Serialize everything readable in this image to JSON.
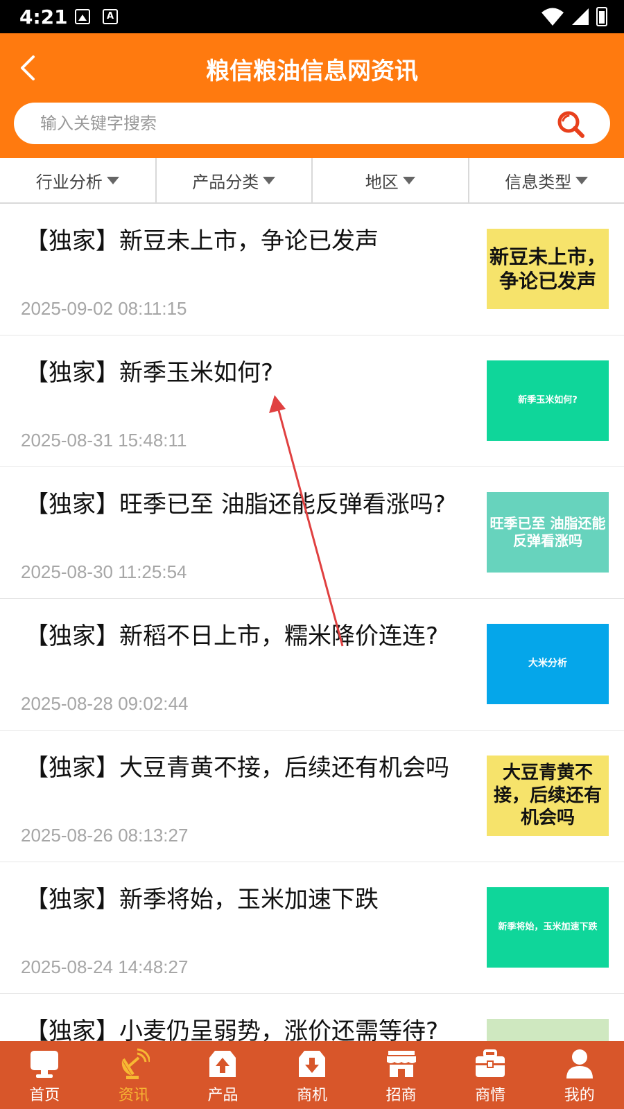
{
  "status_bar": {
    "time": "4:21"
  },
  "header": {
    "title": "粮信粮油信息网资讯"
  },
  "search": {
    "placeholder": "输入关键字搜索"
  },
  "filters": [
    {
      "label": "行业分析"
    },
    {
      "label": "产品分类"
    },
    {
      "label": "地区"
    },
    {
      "label": "信息类型"
    }
  ],
  "news": [
    {
      "title": "【独家】新豆未上市，争论已发声",
      "date": "2025-09-02 08:11:15",
      "thumb_text": "新豆未上市，争论已发声",
      "thumb_bg": "#f6e36b",
      "thumb_color": "#111111"
    },
    {
      "title": "【独家】新季玉米如何?",
      "date": "2025-08-31 15:48:11",
      "thumb_text": "新季玉米如何?",
      "thumb_bg": "#0fd69a",
      "thumb_color": "#ffffff"
    },
    {
      "title": "【独家】旺季已至 油脂还能反弹看涨吗?",
      "date": "2025-08-30 11:25:54",
      "thumb_text": "旺季已至 油脂还能反弹看涨吗",
      "thumb_bg": "#67d3bd",
      "thumb_color": "#ffffff"
    },
    {
      "title": "【独家】新稻不日上市，糯米降价连连?",
      "date": "2025-08-28 09:02:44",
      "thumb_text": "大米分析",
      "thumb_bg": "#05a6ea",
      "thumb_color": "#ffffff"
    },
    {
      "title": "【独家】大豆青黄不接，后续还有机会吗",
      "date": "2025-08-26 08:13:27",
      "thumb_text": "大豆青黄不接，后续还有机会吗",
      "thumb_bg": "#f6e36b",
      "thumb_color": "#111111"
    },
    {
      "title": "【独家】新季将始，玉米加速下跌",
      "date": "2025-08-24 14:48:27",
      "thumb_text": "新季将始，玉米加速下跌",
      "thumb_bg": "#0fd69a",
      "thumb_color": "#ffffff"
    },
    {
      "title": "【独家】小麦仍呈弱势，涨价还需等待?",
      "date": "",
      "thumb_text": "",
      "thumb_bg": "#cfe8c0",
      "thumb_color": "#111111"
    }
  ],
  "bottom_nav": [
    {
      "label": "首页",
      "icon": "monitor-icon"
    },
    {
      "label": "资讯",
      "icon": "satellite-dish-icon"
    },
    {
      "label": "产品",
      "icon": "upload-box-icon"
    },
    {
      "label": "商机",
      "icon": "download-box-icon"
    },
    {
      "label": "招商",
      "icon": "store-icon"
    },
    {
      "label": "商情",
      "icon": "briefcase-icon"
    },
    {
      "label": "我的",
      "icon": "user-icon"
    }
  ],
  "colors": {
    "header_orange": "#ff7a0f",
    "nav_bg": "#d8562a",
    "nav_active": "#f7b833",
    "search_icon": "#e8401c",
    "annotation_arrow": "#e04040"
  }
}
